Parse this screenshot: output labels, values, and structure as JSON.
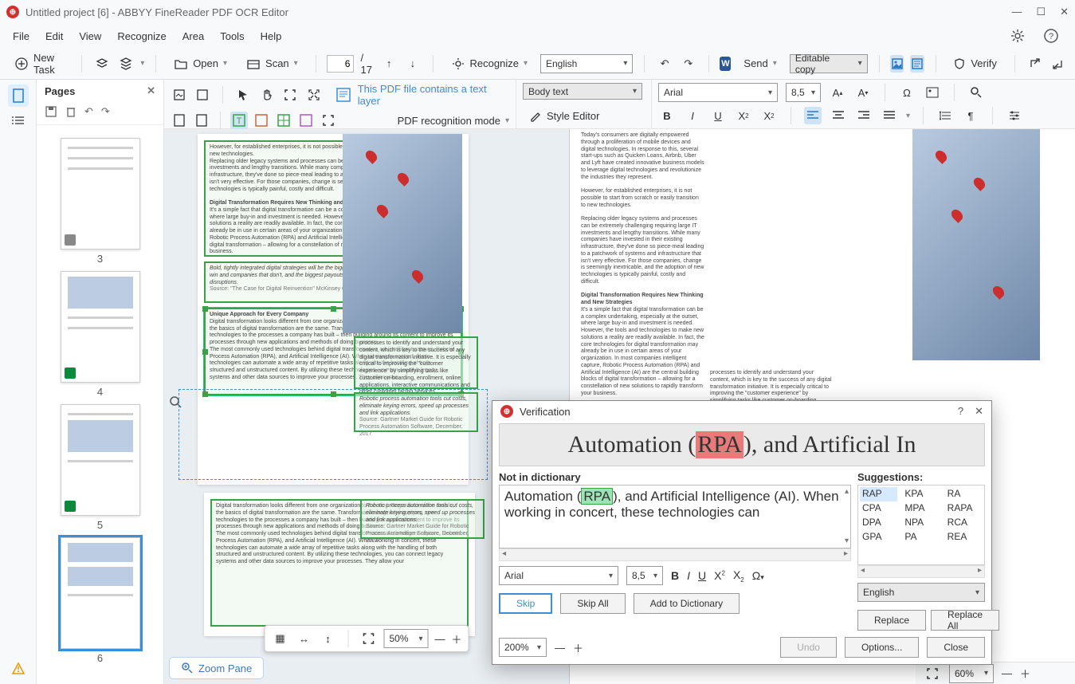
{
  "window": {
    "title": "Untitled project [6] - ABBYY FineReader PDF OCR Editor"
  },
  "menu": {
    "items": [
      "File",
      "Edit",
      "View",
      "Recognize",
      "Area",
      "Tools",
      "Help"
    ]
  },
  "toolbar": {
    "new_task": "New Task",
    "open": "Open",
    "scan": "Scan",
    "page_current": "6",
    "page_total": "/ 17",
    "recognize": "Recognize",
    "language": "English",
    "send": "Send",
    "editable_copy": "Editable copy",
    "verify": "Verify"
  },
  "panels": {
    "pages_label": "Pages",
    "thumb_numbers": [
      "3",
      "4",
      "5",
      "6"
    ]
  },
  "stageheader": {
    "pdf_textlayer": "This PDF file contains a text layer",
    "pdf_mode": "PDF recognition mode",
    "body_text": "Body text",
    "style_editor": "Style Editor",
    "font": "Arial",
    "fontsize": "8,5"
  },
  "zoompane": {
    "label": "Zoom Pane",
    "zoom_val": "50%",
    "right_zoom": "60%"
  },
  "verification": {
    "title": "Verification",
    "not_in_dict": "Not in dictionary",
    "suggestions_label": "Suggestions:",
    "snippet_pre": "Automation (",
    "snippet_word": "RPA",
    "snippet_post": "), and Artificial In",
    "text_pre": "Automation (",
    "text_word": "RPA",
    "text_post1": "), and Artificial Intelligence (AI). When",
    "text_line2": "working in concert, these technologies can",
    "suggestions": [
      "RAP",
      "KPA",
      "RA",
      "CPA",
      "MPA",
      "RAPA",
      "DPA",
      "NPA",
      "RCA",
      "GPA",
      "PA",
      "REA"
    ],
    "font": "Arial",
    "fontsize": "8,5",
    "lang": "English",
    "btn_skip": "Skip",
    "btn_skip_all": "Skip All",
    "btn_add": "Add to Dictionary",
    "btn_replace": "Replace",
    "btn_replace_all": "Replace All",
    "btn_undo": "Undo",
    "btn_options": "Options...",
    "btn_close": "Close",
    "zoom": "200%"
  },
  "doc_text": {
    "para1": "Today's consumers are digitally empowered through a proliferation of mobile devices and digital technologies. In response to this, several start-ups such as Quicken Loans, Airbnb, Uber and Lyft have created innovative business models to leverage digital technologies and revolutionize the industries they represent.",
    "para2": "However, for established enterprises, it is not possible to start from scratch or easily transition to new technologies.",
    "para3": "Replacing older legacy systems and processes can be extremely challenging requiring large IT investments and lengthy transitions. While many companies have invested in their existing infrastructure, they've done so piece-meal leading to a patchwork of systems and infrastructure that isn't very effective. For those companies, change is seemingly inextricable, and the adoption of new technologies is typically painful, costly and difficult.",
    "h1": "Digital Transformation Requires New Thinking and New Strategies",
    "para4": "It's a simple fact that digital transformation can be a complex undertaking, especially at the outset, where large buy-in and investment is needed. However, the tools and technologies to make new solutions a reality are readily available. In fact, the core technologies for digital transformation may already be in use in certain areas of your organization. In most companies intelligent capture, Robotic Process Automation (RPA) and Artificial Intelligence (AI) are the central building blocks of digital transformation – allowing for a constellation of new solutions to rapidly transform your business.",
    "para5_ital": "Bold, tightly integrated digital strategies will be the biggest differentiator between companies that win and companies that don't, and the biggest payouts will go to those that initiate digital disruptions.",
    "src1": "Source: \"The Case for Digital Reinvention\" McKinsey Quarterly, February 2017",
    "h2": "Unique Approach for Every Company",
    "para6": "Digital transformation looks different from one organization to the next. Regardless of the details, the basics of digital transformation are the same. Transformation begins by applying new technologies to the processes a company has built – then building around its content to improve its processes through new applications and methods of doing business.",
    "para7": "The most commonly used technologies behind digital transformation are intelligent capture, Robotic Process Automation (RPA), and Artificial Intelligence (AI). When working in concert, these technologies can automate a wide array of repetitive tasks along with the handling of both structured and unstructured content. By utilizing these technologies, you can connect legacy systems and other data sources to improve your processes. They allow your",
    "side1": "processes to identify and understand your content, which is key to the success of any digital transformation initiative. It is especially critical to improving the \"customer experience\" by simplifying tasks like customer on-boarding, enrollment, online applications, interactive communications and other customer facing services.",
    "side2_ital": "Robotic process automation tools cut costs, eliminate keying errors, speed up processes and link applications.",
    "src2": "Source: Gartner Market Guide for Robotic Process Automation Software, December, 2017"
  }
}
